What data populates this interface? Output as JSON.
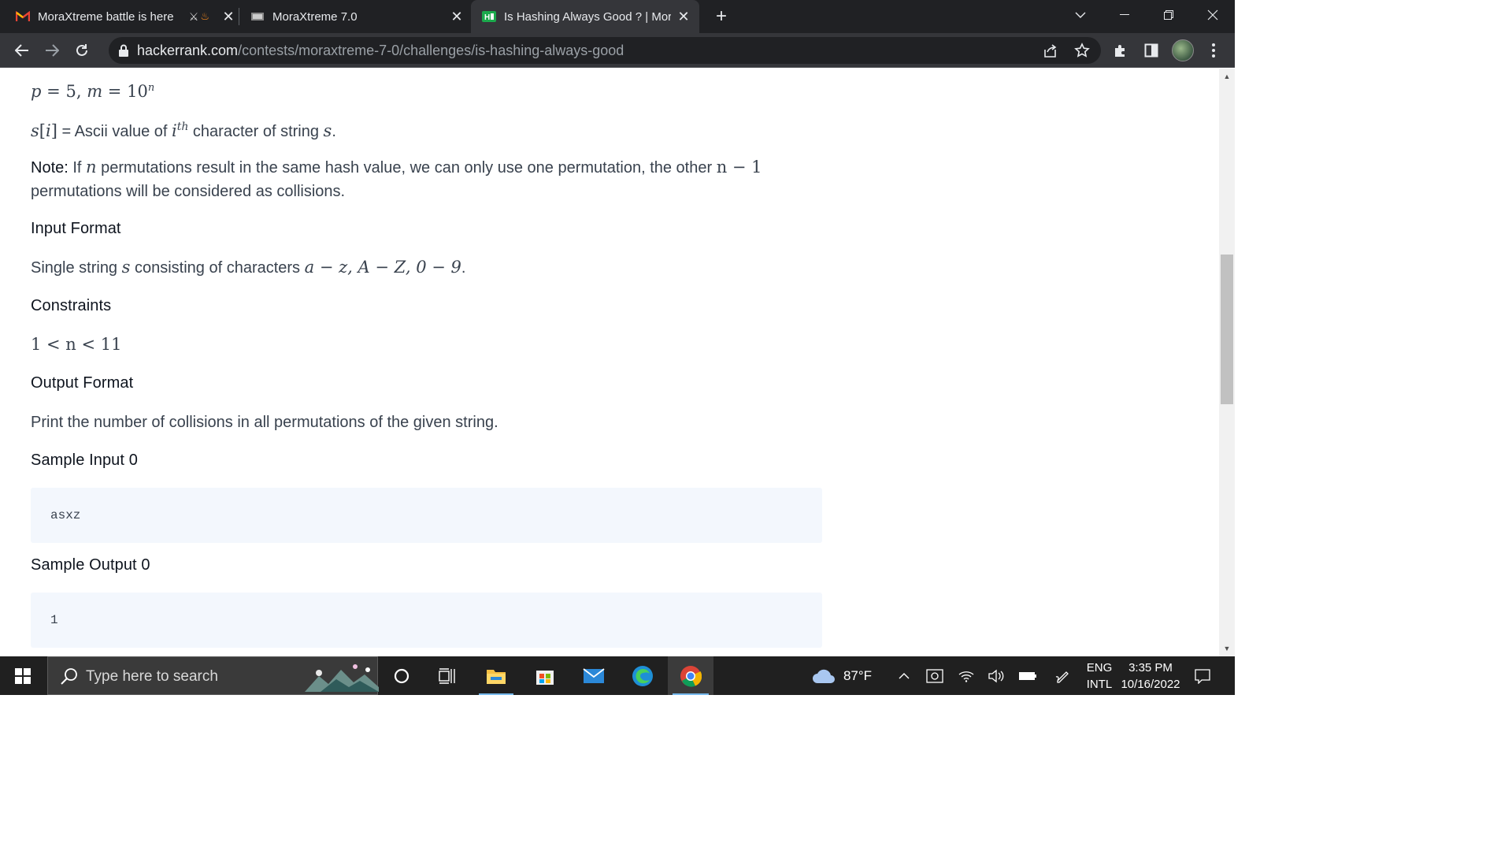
{
  "browser": {
    "tabs": [
      {
        "title": "MoraXtreme battle is here",
        "active": false,
        "favicon": "gmail-icon"
      },
      {
        "title": "MoraXtreme 7.0",
        "active": false,
        "favicon": "site-icon"
      },
      {
        "title": "Is Hashing Always Good ? | Mora",
        "active": true,
        "favicon": "hackerrank-icon"
      }
    ],
    "url_host": "hackerrank.com",
    "url_path": "/contests/moraxtreme-7-0/challenges/is-hashing-always-good",
    "theme_color": "#202124",
    "toolbar_color": "#35363a"
  },
  "problem": {
    "formula_line": {
      "p": "p",
      "eq": "=",
      "p_val": "5",
      "comma": ",",
      "m": "m",
      "eq2": "=",
      "m_base": "10",
      "m_exp": "n"
    },
    "ascii_line": {
      "s": "s",
      "bracket_open": "[",
      "i": "i",
      "bracket_close": "]",
      "text_a": " = Ascii value of ",
      "i2": "i",
      "th": "th",
      "text_b": " character of string ",
      "s2": "s",
      "period": "."
    },
    "note": {
      "label": "Note:",
      "text_a": " If ",
      "n": "n",
      "text_b": " permutations result in the same hash value, we can only use one permutation, the other ",
      "n_minus_1": "n − 1",
      "text_c": "permutations will be considered as collisions."
    },
    "input_format": {
      "heading": "Input Format",
      "text_a": "Single string ",
      "s": "s",
      "text_b": " consisting of characters ",
      "chars": "a − z, A − Z, 0 − 9",
      "period": "."
    },
    "constraints": {
      "heading": "Constraints",
      "expr": "1 < n < 11"
    },
    "output_format": {
      "heading": "Output Format",
      "text": "Print the number of collisions in all permutations of the given string."
    },
    "sample_input": {
      "heading": "Sample Input 0",
      "code": "asxz"
    },
    "sample_output": {
      "heading": "Sample Output 0",
      "code": "1"
    },
    "code_bg": "#f3f7fd",
    "text_color": "#39424e",
    "heading_color": "#0e141e"
  },
  "taskbar": {
    "search_placeholder": "Type here to search",
    "weather": "87°F",
    "lang_top": "ENG",
    "lang_bottom": "INTL",
    "time": "3:35 PM",
    "date": "10/16/2022"
  }
}
